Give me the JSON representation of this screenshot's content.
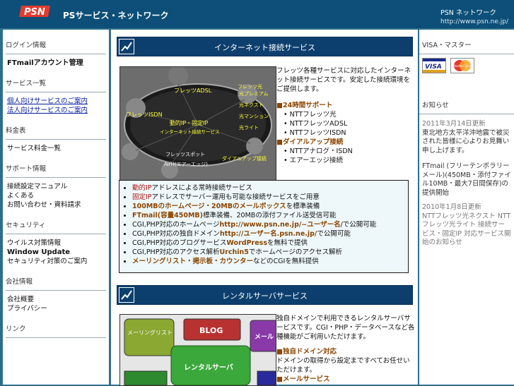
{
  "header": {
    "site_title": "PSサービス・ネットワーク",
    "right_title": "PSN ネットワーク",
    "url": "http://www.psn.ne.jp/"
  },
  "colors": {
    "header_bg": "#0d4f78",
    "banner_bg": "#0d3f6e",
    "accent": "#8b4500",
    "link": "#001a9a"
  },
  "left": {
    "sections": [
      {
        "title": "ログイン情報",
        "links": [
          {
            "label": "FTmailアカウント管理",
            "style": "bold"
          }
        ]
      },
      {
        "title": "サービス一覧",
        "links": [
          {
            "label": "個人向けサービスのご案内",
            "style": "blue"
          },
          {
            "label": "法人向けサービスのご案内",
            "style": "blue"
          }
        ]
      },
      {
        "title": "料金表",
        "links": [
          {
            "label": "サービス料金一覧",
            "style": ""
          }
        ]
      },
      {
        "title": "サポート情報",
        "links": [
          {
            "label": "接続設定マニュアル",
            "style": ""
          },
          {
            "label": "よくある",
            "style": ""
          },
          {
            "label": "お問い合わせ・資料請求",
            "style": ""
          }
        ]
      },
      {
        "title": "セキュリティ",
        "links": [
          {
            "label": "ウイルス対策情報",
            "style": ""
          },
          {
            "label": "Window Update",
            "style": "bold"
          },
          {
            "label": "セキュリティ対策のご案内",
            "style": ""
          }
        ]
      },
      {
        "title": "会社情報",
        "links": [
          {
            "label": "会社概要",
            "style": ""
          },
          {
            "label": "プライバシー",
            "style": ""
          }
        ]
      },
      {
        "title": "リンク",
        "links": []
      }
    ]
  },
  "main": {
    "banner1": {
      "title": "インターネット接続サービス"
    },
    "photo1_labels": [
      "フレッツADSL",
      "フレッツISDN",
      "光ネクスト",
      "光プレミアム",
      "光マンション",
      "光ライト",
      "フレッツ光",
      "動的IP・固定IP",
      "インターネット接続サービス",
      "フレッツスポット",
      "ダイアルアップ接続",
      "AirH(エアーエッジ)"
    ],
    "intro1_text": "フレッツ各種サービスに対応したインターネット接続サービスです。安定した接続環境をご提供します。",
    "intro1_heading": "■24時間サポート",
    "intro1_items": [
      "NTTフレッツ光",
      "NTTフレッツADSL",
      "NTTフレッツISDN"
    ],
    "intro1_heading2": "■ダイアルアップ接続",
    "intro1_items2": [
      "NTTアナログ・ISDN",
      "エアーエッジ接続"
    ],
    "features": [
      {
        "pre": "",
        "hl": "動的IP",
        "post": "アドレスによる常時接続サービス",
        "hl_style": "red"
      },
      {
        "pre": "",
        "hl": "固定IP",
        "post": "アドレスでサーバー運用も可能な接続サービスをご用意",
        "hl_style": "red"
      },
      {
        "pre": "",
        "hl": "100MBのホームページ・20MBのメールボックス",
        "post": "を標準装備",
        "hl_style": "fbold"
      },
      {
        "pre": "",
        "hl": "FTmail(容量450MB)",
        "post": "標準装備、20MBの添付ファイル送受信可能",
        "hl_style": "fbold"
      },
      {
        "pre": "CGI,PHP対応のホームページ",
        "hl": "http://www.psn.ne.jp/~ユーザー名",
        "post": "/で公開可能",
        "hl_style": "fbold"
      },
      {
        "pre": "CGI,PHP対応の独自ドメイン",
        "hl": "http://ユーザー名.psn.ne.jp/",
        "post": "で公開可能",
        "hl_style": "fbold"
      },
      {
        "pre": "CGI,PHP対応のブログサービス",
        "hl": "WordPress",
        "post": "を無料で提供",
        "hl_style": "fbold"
      },
      {
        "pre": "CGI,PHP対応のアクセス解析",
        "hl": "Urchin5",
        "post": "でホームページのアクセス解析",
        "hl_style": "fbold"
      },
      {
        "pre": "",
        "hl": "メーリングリスト・掲示板・カウンター",
        "post": "などのCGIを無料提供",
        "hl_style": "fbold"
      }
    ],
    "banner2": {
      "title": "レンタルサーバサービス"
    },
    "photo2_labels": [
      "メーリングリスト",
      "BLOG",
      "メール",
      "レンタルサーバ"
    ],
    "intro2_text": "独自ドメインで利用できるレンタルサーバサービスです。CGI・PHP・データベースなど各種機能がご利用いただけます。",
    "intro2_heading": "■独自ドメイン対応",
    "intro2_sub": "ドメインの取得から設定まですべてお任せいただけます。",
    "intro2_heading2": "■メールサービス"
  },
  "right": {
    "visa_title": "VISA・マスター",
    "cards": [
      "VISA",
      "MasterCard"
    ],
    "news_title": "お知らせ",
    "news": [
      {
        "date": "2011年3月14日更新",
        "text": "東北地方太平洋沖地震で被災された皆様に心よりお見舞い申し上げます。"
      },
      {
        "date": "",
        "text": "FTmail (フリーテンポラリーメール)(450MB・添付ファイル10MB・最大7日間保存)の提供開始"
      },
      {
        "date": "2010年1月8日更新",
        "text": "NTTフレッツ光ネクスト NTTフレッツ光ライト 接続サービス・固定IP 対応サービス開始のお知らせ"
      }
    ]
  }
}
